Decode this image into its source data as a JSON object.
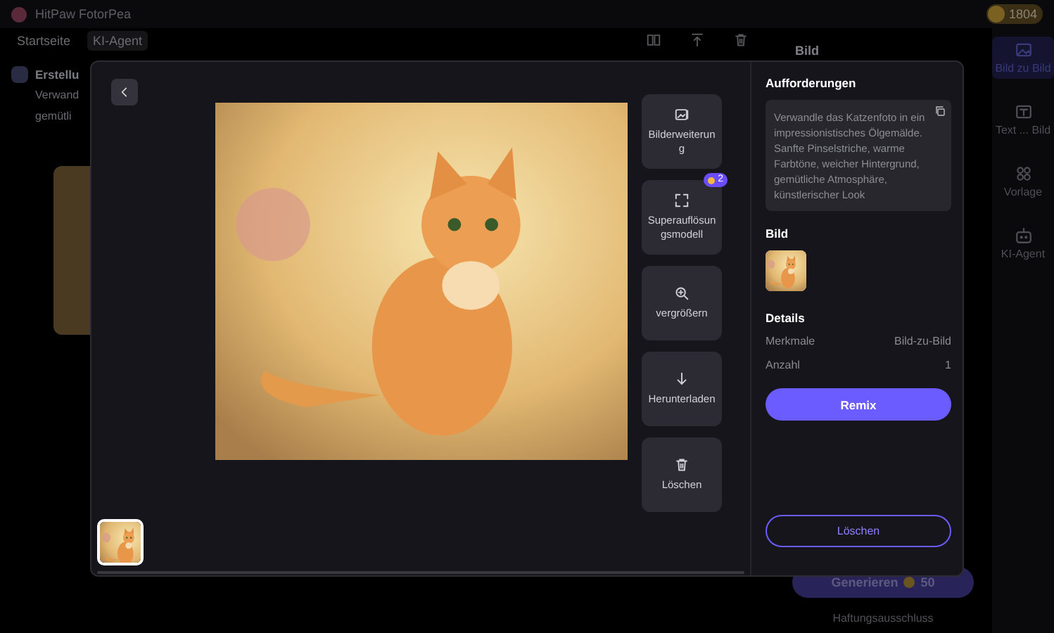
{
  "app": {
    "title": "HitPaw FotorPea",
    "credits": "1804"
  },
  "nav": [
    {
      "label": "Startseite",
      "selected": false
    },
    {
      "label": "KI-Agent",
      "selected": true
    }
  ],
  "chat": {
    "title": "Erstellu",
    "lines": [
      "Verwand",
      "gemütli"
    ]
  },
  "panel": {
    "title": "Bild",
    "generate": "Generieren",
    "cost": "50",
    "disclaimer": "Haftungsausschluss"
  },
  "side_tabs": [
    {
      "label": "Bild zu Bild",
      "selected": true,
      "kind": "image"
    },
    {
      "label": "Text ... Bild",
      "selected": false,
      "kind": "text"
    },
    {
      "label": "Vorlage",
      "selected": false,
      "kind": "grid"
    },
    {
      "label": "KI-Agent",
      "selected": false,
      "kind": "bot"
    }
  ],
  "tools": [
    {
      "label": "Bilderweiterung",
      "kind": "expand"
    },
    {
      "label": "Superauflösungsmodell",
      "kind": "upscale",
      "badge": "2"
    },
    {
      "label": "vergrößern",
      "kind": "zoom"
    },
    {
      "label": "Herunterladen",
      "kind": "download"
    },
    {
      "label": "Löschen",
      "kind": "delete"
    }
  ],
  "thumbnails": [
    {
      "selected": true
    }
  ],
  "details_panel": {
    "prompt_title": "Aufforderungen",
    "prompt": "Verwandle das Katzenfoto in ein impressionistisches Ölgemälde. Sanfte Pinselstriche, warme Farbtöne, weicher Hintergrund, gemütliche Atmosphäre, künstlerischer Look",
    "image_title": "Bild",
    "details_title": "Details",
    "details": [
      {
        "label": "Merkmale",
        "value": "Bild-zu-Bild"
      },
      {
        "label": "Anzahl",
        "value": "1"
      }
    ],
    "remix": "Remix",
    "delete": "Löschen"
  }
}
